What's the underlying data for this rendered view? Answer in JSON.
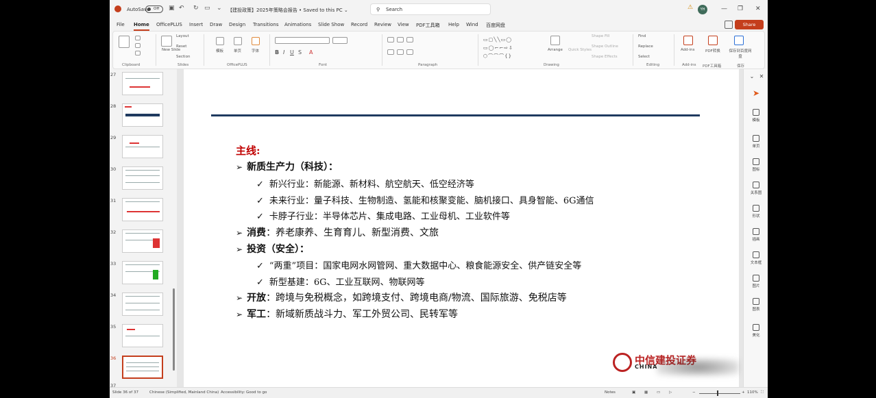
{
  "titlebar": {
    "autosave": "AutoSave",
    "autosave_state": "Off",
    "document": "【建投政策】2025年策略会报告 • Saved to this PC ⌄",
    "search_placeholder": "Search",
    "avatar": "YH"
  },
  "menu": {
    "tabs": [
      "File",
      "Home",
      "OfficePLUS",
      "Insert",
      "Draw",
      "Design",
      "Transitions",
      "Animations",
      "Slide Show",
      "Record",
      "Review",
      "View",
      "PDF工具箱",
      "Help",
      "Wind",
      "百度网盘"
    ],
    "share": "Share"
  },
  "ribbon": {
    "groups": [
      "Clipboard",
      "Slides",
      "OfficePLUS",
      "Font",
      "Paragraph",
      "Drawing",
      "Editing",
      "Add-ins",
      "PDF工具箱",
      "保存"
    ],
    "new_slide": "New Slide",
    "layout": "Layout",
    "reset": "Reset",
    "section": "Section",
    "template": "模板",
    "single_page": "单页",
    "font_btn": "字体",
    "arrange": "Arrange",
    "quick_styles": "Quick Styles",
    "shape_fill": "Shape Fill",
    "shape_outline": "Shape Outline",
    "shape_effects": "Shape Effects",
    "find": "Find",
    "replace": "Replace",
    "select": "Select",
    "addins": "Add-ins",
    "pdf_convert": "PDF转换",
    "save_baidu": "保存到百度网盘"
  },
  "thumbnails": [
    "27",
    "28",
    "29",
    "30",
    "31",
    "32",
    "33",
    "34",
    "35",
    "36",
    "37"
  ],
  "slide": {
    "heading": "主线:",
    "lines": [
      {
        "level": 1,
        "bold": "新质生产力（科技）：",
        "text": ""
      },
      {
        "level": 2,
        "text": "新兴行业：新能源、新材料、航空航天、低空经济等"
      },
      {
        "level": 2,
        "text": "未来行业：量子科技、生物制造、氢能和核聚变能、脑机接口、具身智能、6G通信"
      },
      {
        "level": 2,
        "text": "卡脖子行业：半导体芯片、集成电路、工业母机、工业软件等"
      },
      {
        "level": 1,
        "bold": "消费",
        "text": "：养老康养、生育育儿、新型消费、文旅"
      },
      {
        "level": 1,
        "bold": "投资（安全）：",
        "text": ""
      },
      {
        "level": 2,
        "text": "“两重”项目：国家电网水网管网、重大数据中心、粮食能源安全、供产链安全等"
      },
      {
        "level": 2,
        "text": "新型基建：6G、工业互联网、物联网等"
      },
      {
        "level": 1,
        "bold": "开放",
        "text": "：跨境与免税概念，如跨境支付、跨境电商/物流、国际旅游、免税店等"
      },
      {
        "level": 1,
        "bold": "军工",
        "text": "：新域新质战斗力、军工外贸公司、民转军等"
      }
    ],
    "logo_text": "中信建投证券",
    "logo_sub": "CHINA"
  },
  "right_pane": [
    "模板",
    "单页",
    "图标",
    "关系图",
    "形状",
    "插画",
    "文本框",
    "图片",
    "图表",
    "美化"
  ],
  "status": {
    "slide": "Slide 36 of 37",
    "language": "Chinese (Simplified, Mainland China)",
    "accessibility": "Accessibility: Good to go",
    "notes": "Notes",
    "zoom": "110%"
  }
}
